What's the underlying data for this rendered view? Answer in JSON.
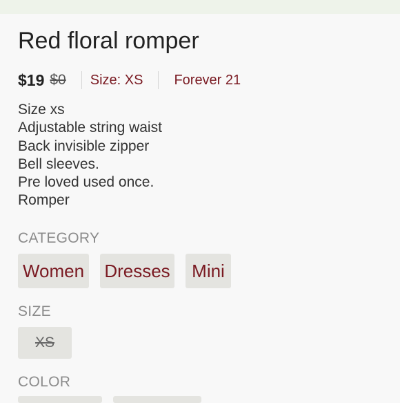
{
  "listing": {
    "title": "Red floral romper",
    "price": "$19",
    "original_price": "$0",
    "size_meta": "Size: XS",
    "brand": "Forever 21"
  },
  "description": [
    "Size xs",
    "Adjustable string waist",
    "Back invisible zipper",
    "Bell sleeves.",
    "Pre loved used once.",
    "Romper"
  ],
  "sections": {
    "category_label": "CATEGORY",
    "size_label": "SIZE",
    "color_label": "COLOR"
  },
  "categories": [
    "Women",
    "Dresses",
    "Mini"
  ],
  "size_chip": "XS",
  "colors": {
    "accent": "#7a1a22",
    "chip_bg": "#e4e4e0",
    "label_gray": "#8b8b8b"
  }
}
